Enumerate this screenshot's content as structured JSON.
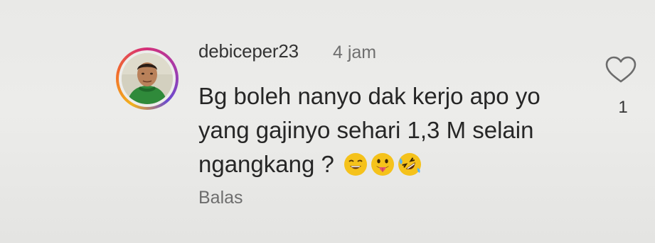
{
  "comment": {
    "username": "debiceper23",
    "timestamp": "4 jam",
    "lines": [
      "Bg boleh nanyo dak kerjo apo yo",
      "yang gajinyo sehari 1,3 M selain",
      "ngangkang ?"
    ],
    "emojis": [
      "grinning-face-icon",
      "tongue-out-face-icon",
      "rolling-laughing-face-icon"
    ],
    "reply_label": "Balas",
    "like_count": "1",
    "like_icon": "heart-outline-icon"
  },
  "colors": {
    "avatar_ring": [
      "#f2b21d",
      "#f26c2b",
      "#d62f77",
      "#a93aa8"
    ],
    "emoji_yellow": "#f5c21b"
  }
}
